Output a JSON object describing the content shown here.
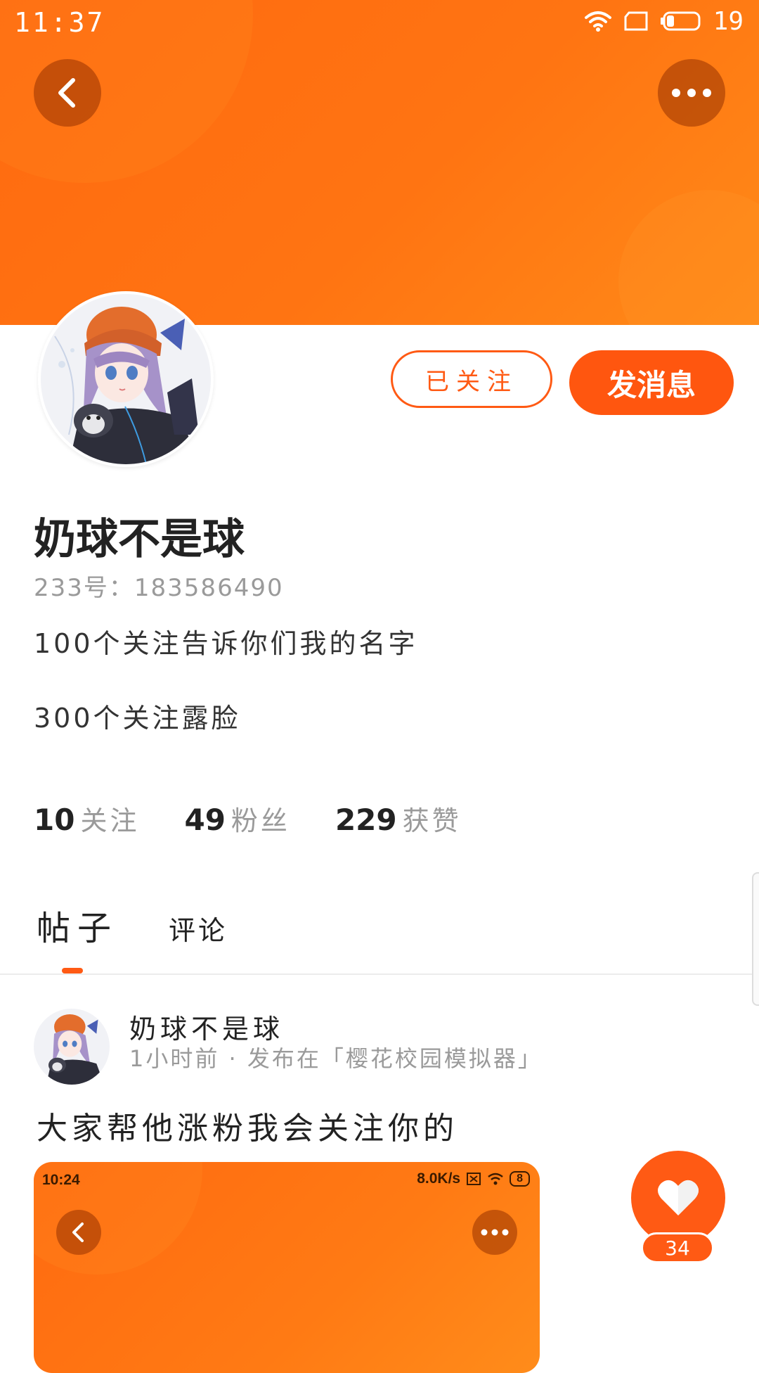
{
  "status_bar": {
    "time": "11:37",
    "battery_level": "19",
    "icons": [
      "wifi-icon",
      "sim-icon",
      "battery-icon"
    ]
  },
  "header": {
    "back_icon": "back-arrow-icon",
    "more_icon": "more-dots-icon",
    "accent_color": "#ff6a10"
  },
  "profile": {
    "avatar": "anime-girl-avatar",
    "followed_label": "已关注",
    "message_label": "发消息",
    "username": "奶球不是球",
    "id_label": "233号：",
    "id_value": "183586490",
    "bio_line1": "100个关注告诉你们我的名字",
    "bio_line2": "300个关注露脸"
  },
  "stats": [
    {
      "value": "10",
      "label": "关注"
    },
    {
      "value": "49",
      "label": "粉丝"
    },
    {
      "value": "229",
      "label": "获赞"
    }
  ],
  "tabs": {
    "posts": "帖子",
    "comments": "评论",
    "active": "posts"
  },
  "post": {
    "author": "奶球不是球",
    "meta": "1小时前 · 发布在「樱花校园模拟器」",
    "text": "大家帮他涨粉我会关注你的",
    "image": {
      "time": "10:24",
      "net_speed": "8.0K/s",
      "battery": "8"
    }
  },
  "like": {
    "icon": "heart-icon",
    "count": "34"
  }
}
